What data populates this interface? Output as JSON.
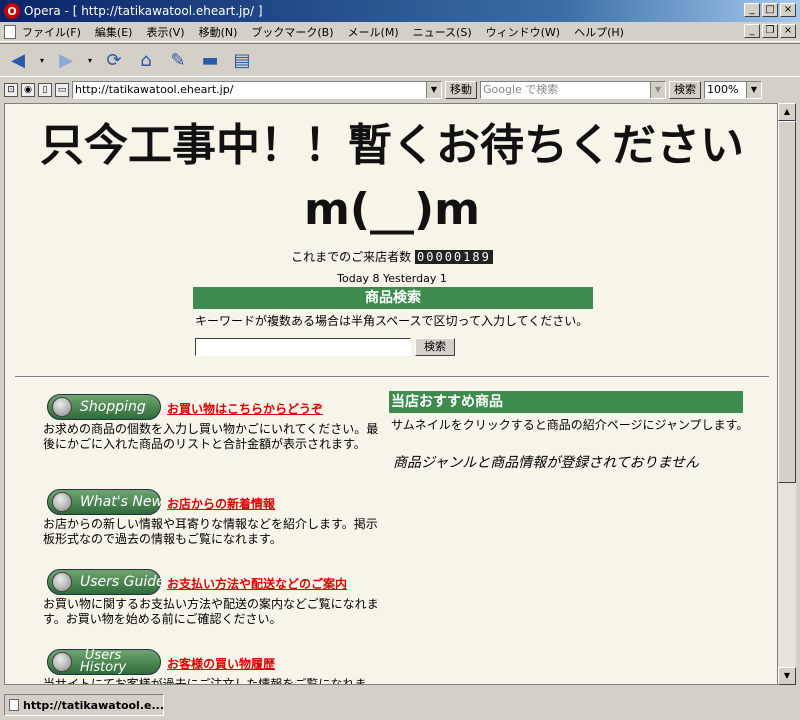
{
  "window": {
    "title": "Opera - [ http://tatikawatool.eheart.jp/ ]"
  },
  "menu": [
    "ファイル(F)",
    "編集(E)",
    "表示(V)",
    "移動(N)",
    "ブックマーク(B)",
    "メール(M)",
    "ニュース(S)",
    "ウィンドウ(W)",
    "ヘルプ(H)"
  ],
  "address": {
    "url": "http://tatikawatool.eheart.jp/",
    "go_label": "移動",
    "search_placeholder": "Google で検索",
    "search_label": "検索",
    "zoom": "100%"
  },
  "page": {
    "heading_line1": "只今工事中！！暫くお待ちください",
    "heading_line2": "m(__)m",
    "counter_label": "これまでのご来店者数",
    "counter_value": "00000189",
    "today_line": "Today 8  Yesterday 1",
    "search_title": "商品検索",
    "search_hint": "キーワードが複数ある場合は半角スペースで区切って入力してください。",
    "search_button": "検索"
  },
  "sections": [
    {
      "pill": "Shopping",
      "link": "お買い物はこちらからどうぞ",
      "desc": "お求めの商品の個数を入力し買い物かごにいれてください。最後にかごに入れた商品のリストと合計金額が表示されます。"
    },
    {
      "pill": "What's New",
      "link": "お店からの新着情報",
      "desc": "お店からの新しい情報や耳寄りな情報などを紹介します。掲示板形式なので過去の情報もご覧になれます。"
    },
    {
      "pill": "Users Guide",
      "link": "お支払い方法や配送などのご案内",
      "desc": "お買い物に関するお支払い方法や配送の案内などご覧になれます。お買い物を始める前にご確認ください。"
    },
    {
      "pill_line1": "Users",
      "pill_line2": "History",
      "link": "お客様の買い物履歴",
      "desc": "当サイトにてお客様が過去にご注文した情報をご覧になれます。"
    }
  ],
  "recommend": {
    "title": "当店おすすめ商品",
    "hint": "サムネイルをクリックすると商品の紹介ページにジャンプします。",
    "empty": "商品ジャンルと商品情報が登録されておりません"
  },
  "status": {
    "text": "http://tatikawatool.e..."
  }
}
